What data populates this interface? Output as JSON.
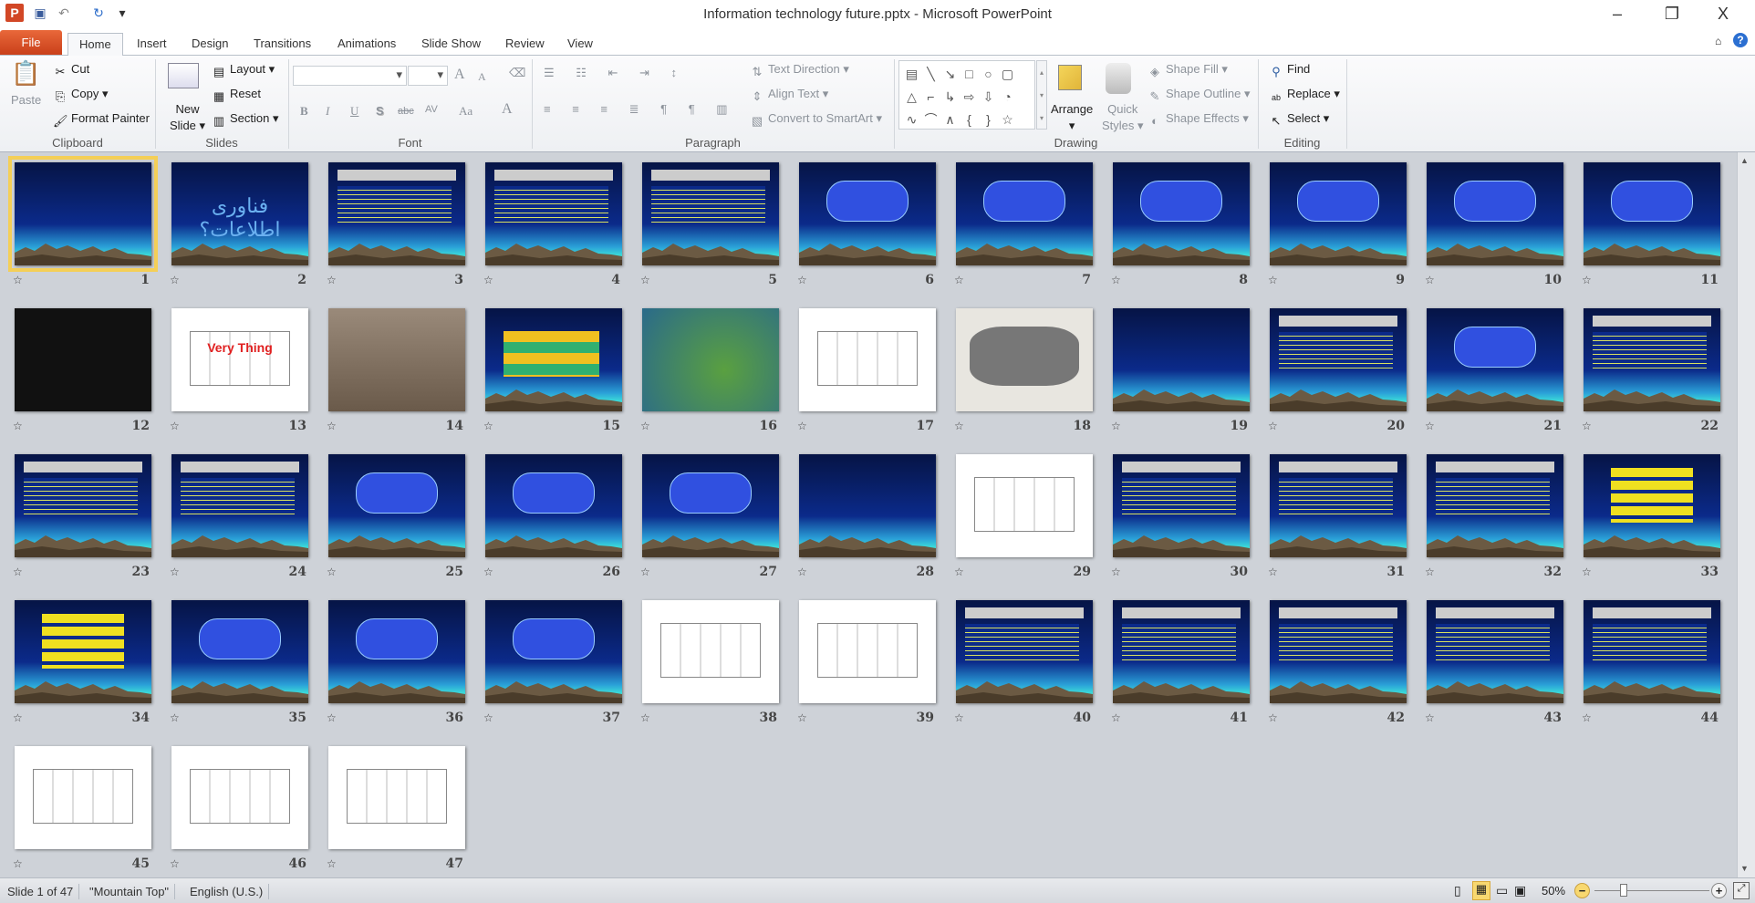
{
  "window": {
    "title": "Information technology future.pptx - Microsoft PowerPoint",
    "app_icon": "P",
    "minimize": "–",
    "restore": "❐",
    "close": "X"
  },
  "tabs": {
    "file": "File",
    "items": [
      "Home",
      "Insert",
      "Design",
      "Transitions",
      "Animations",
      "Slide Show",
      "Review",
      "View"
    ],
    "active": "Home"
  },
  "ribbon": {
    "clipboard": {
      "label": "Clipboard",
      "paste": "Paste",
      "cut": "Cut",
      "copy": "Copy",
      "format_painter": "Format Painter"
    },
    "slides": {
      "label": "Slides",
      "new_slide_1": "New",
      "new_slide_2": "Slide",
      "layout": "Layout",
      "reset": "Reset",
      "section": "Section"
    },
    "font": {
      "label": "Font",
      "font_name": "",
      "font_size": "",
      "bold": "B",
      "italic": "I",
      "underline": "U",
      "shadow": "S",
      "strike": "abc",
      "spacing": "AV",
      "case": "Aa",
      "color": "A",
      "grow": "A",
      "shrink": "A"
    },
    "paragraph": {
      "label": "Paragraph",
      "text_direction": "Text Direction",
      "align_text": "Align Text",
      "smartart": "Convert to SmartArt"
    },
    "drawing": {
      "label": "Drawing",
      "arrange": "Arrange",
      "quick_styles_1": "Quick",
      "quick_styles_2": "Styles",
      "shape_fill": "Shape Fill",
      "shape_outline": "Shape Outline",
      "shape_effects": "Shape Effects",
      "shapes": [
        "▤",
        "╲",
        "↘",
        "□",
        "○",
        "▢",
        "△",
        "⌐",
        "↳",
        "⇨",
        "⇩",
        "◔",
        "∿",
        "⌒",
        "∧",
        "{",
        "}",
        "☆"
      ]
    },
    "editing": {
      "label": "Editing",
      "find": "Find",
      "replace": "Replace",
      "select": "Select"
    }
  },
  "slides": [
    {
      "n": "1",
      "theme": "calligraphy"
    },
    {
      "n": "2",
      "theme": "mountain",
      "title": "فناوری اطلاعات؟"
    },
    {
      "n": "3",
      "theme": "text"
    },
    {
      "n": "4",
      "theme": "text"
    },
    {
      "n": "5",
      "theme": "text"
    },
    {
      "n": "6",
      "theme": "diagram"
    },
    {
      "n": "7",
      "theme": "diagram"
    },
    {
      "n": "8",
      "theme": "diagram"
    },
    {
      "n": "9",
      "theme": "diagram"
    },
    {
      "n": "10",
      "theme": "diagram"
    },
    {
      "n": "11",
      "theme": "diagram"
    },
    {
      "n": "12",
      "theme": "dark"
    },
    {
      "n": "13",
      "theme": "white",
      "title": "Very Thing"
    },
    {
      "n": "14",
      "theme": "trees"
    },
    {
      "n": "15",
      "theme": "table"
    },
    {
      "n": "16",
      "theme": "green"
    },
    {
      "n": "17",
      "theme": "white"
    },
    {
      "n": "18",
      "theme": "map"
    },
    {
      "n": "19",
      "theme": "mountain"
    },
    {
      "n": "20",
      "theme": "text"
    },
    {
      "n": "21",
      "theme": "diagram"
    },
    {
      "n": "22",
      "theme": "text"
    },
    {
      "n": "23",
      "theme": "text"
    },
    {
      "n": "24",
      "theme": "text"
    },
    {
      "n": "25",
      "theme": "diagram"
    },
    {
      "n": "26",
      "theme": "diagram"
    },
    {
      "n": "27",
      "theme": "diagram"
    },
    {
      "n": "28",
      "theme": "mountain"
    },
    {
      "n": "29",
      "theme": "white"
    },
    {
      "n": "30",
      "theme": "text"
    },
    {
      "n": "31",
      "theme": "text"
    },
    {
      "n": "32",
      "theme": "text"
    },
    {
      "n": "33",
      "theme": "yellow"
    },
    {
      "n": "34",
      "theme": "yellow"
    },
    {
      "n": "35",
      "theme": "diagram"
    },
    {
      "n": "36",
      "theme": "diagram"
    },
    {
      "n": "37",
      "theme": "diagram"
    },
    {
      "n": "38",
      "theme": "white"
    },
    {
      "n": "39",
      "theme": "white"
    },
    {
      "n": "40",
      "theme": "text"
    },
    {
      "n": "41",
      "theme": "text"
    },
    {
      "n": "42",
      "theme": "text"
    },
    {
      "n": "43",
      "theme": "text"
    },
    {
      "n": "44",
      "theme": "text"
    },
    {
      "n": "45",
      "theme": "white"
    },
    {
      "n": "46",
      "theme": "white"
    },
    {
      "n": "47",
      "theme": "white"
    }
  ],
  "selected_slide": "1",
  "status": {
    "slide": "Slide 1 of 47",
    "theme": "\"Mountain Top\"",
    "language": "English (U.S.)",
    "zoom": "50%",
    "zoom_percent": 50
  },
  "colors": {
    "accent": "#e0592c",
    "selection": "#f4cf57",
    "slide_bg": "#0c1f6e"
  }
}
